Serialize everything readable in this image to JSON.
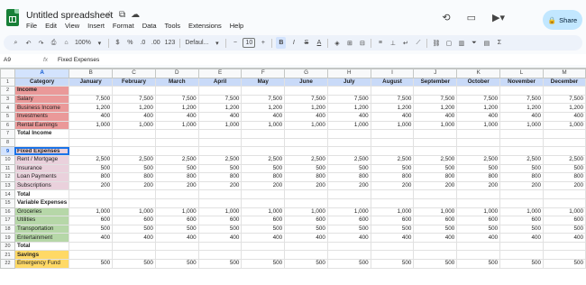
{
  "app": {
    "title": "Untitled spreadsheet",
    "menu": [
      "File",
      "Edit",
      "View",
      "Insert",
      "Format",
      "Data",
      "Tools",
      "Extensions",
      "Help"
    ],
    "share_label": "Share"
  },
  "toolbar": {
    "zoom": "100%",
    "currency": "$",
    "percent": "%",
    "dec_dec": ".0",
    "inc_dec": ".00",
    "format_123": "123",
    "font": "Defaul...",
    "font_size": "10",
    "minus": "−",
    "plus": "+",
    "bold": "B",
    "italic": "I",
    "strike": "S",
    "text_color": "A"
  },
  "formula_bar": {
    "cell_ref": "A9",
    "fx": "fx",
    "value": "Fixed Expenses"
  },
  "columns": [
    "A",
    "B",
    "C",
    "D",
    "E",
    "F",
    "G",
    "H",
    "I",
    "J",
    "K",
    "L",
    "M"
  ],
  "rows": [
    {
      "n": "1",
      "cells": [
        "Category",
        "January",
        "February",
        "March",
        "April",
        "May",
        "June",
        "July",
        "August",
        "September",
        "October",
        "November",
        "December"
      ],
      "type": "header"
    },
    {
      "n": "2",
      "cells": [
        "Income",
        "",
        "",
        "",
        "",
        "",
        "",
        "",
        "",
        "",
        "",
        "",
        ""
      ],
      "type": "section",
      "color": "red"
    },
    {
      "n": "3",
      "cells": [
        "Salary",
        "7,500",
        "7,500",
        "7,500",
        "7,500",
        "7,500",
        "7,500",
        "7,500",
        "7,500",
        "7,500",
        "7,500",
        "7,500",
        "7,500"
      ],
      "color": "red"
    },
    {
      "n": "4",
      "cells": [
        "Business Income",
        "1,200",
        "1,200",
        "1,200",
        "1,200",
        "1,200",
        "1,200",
        "1,200",
        "1,200",
        "1,200",
        "1,200",
        "1,200",
        "1,200"
      ],
      "color": "red"
    },
    {
      "n": "5",
      "cells": [
        "Investments",
        "400",
        "400",
        "400",
        "400",
        "400",
        "400",
        "400",
        "400",
        "400",
        "400",
        "400",
        "400"
      ],
      "color": "red"
    },
    {
      "n": "6",
      "cells": [
        "Rental Earnings",
        "1,000",
        "1,000",
        "1,000",
        "1,000",
        "1,000",
        "1,000",
        "1,000",
        "1,000",
        "1,000",
        "1,000",
        "1,000",
        "1,000"
      ],
      "color": "red"
    },
    {
      "n": "7",
      "cells": [
        "Total Income",
        "",
        "",
        "",
        "",
        "",
        "",
        "",
        "",
        "",
        "",
        "",
        ""
      ],
      "type": "bold"
    },
    {
      "n": "8",
      "cells": [
        "",
        "",
        "",
        "",
        "",
        "",
        "",
        "",
        "",
        "",
        "",
        "",
        ""
      ]
    },
    {
      "n": "9",
      "cells": [
        "Fixed Expenses",
        "",
        "",
        "",
        "",
        "",
        "",
        "",
        "",
        "",
        "",
        "",
        ""
      ],
      "type": "section",
      "color": "pink",
      "active": true
    },
    {
      "n": "10",
      "cells": [
        "Rent / Mortgage",
        "2,500",
        "2,500",
        "2,500",
        "2,500",
        "2,500",
        "2,500",
        "2,500",
        "2,500",
        "2,500",
        "2,500",
        "2,500",
        "2,500"
      ],
      "color": "pink"
    },
    {
      "n": "11",
      "cells": [
        "Insurance",
        "500",
        "500",
        "500",
        "500",
        "500",
        "500",
        "500",
        "500",
        "500",
        "500",
        "500",
        "500"
      ],
      "color": "pink"
    },
    {
      "n": "12",
      "cells": [
        "Loan Payments",
        "800",
        "800",
        "800",
        "800",
        "800",
        "800",
        "800",
        "800",
        "800",
        "800",
        "800",
        "800"
      ],
      "color": "pink"
    },
    {
      "n": "13",
      "cells": [
        "Subscriptions",
        "200",
        "200",
        "200",
        "200",
        "200",
        "200",
        "200",
        "200",
        "200",
        "200",
        "200",
        "200"
      ],
      "color": "pink"
    },
    {
      "n": "14",
      "cells": [
        "Total",
        "",
        "",
        "",
        "",
        "",
        "",
        "",
        "",
        "",
        "",
        "",
        ""
      ],
      "type": "bold"
    },
    {
      "n": "15",
      "cells": [
        "Variable Expenses",
        "",
        "",
        "",
        "",
        "",
        "",
        "",
        "",
        "",
        "",
        "",
        ""
      ],
      "type": "bold"
    },
    {
      "n": "16",
      "cells": [
        "Groceries",
        "1,000",
        "1,000",
        "1,000",
        "1,000",
        "1,000",
        "1,000",
        "1,000",
        "1,000",
        "1,000",
        "1,000",
        "1,000",
        "1,000"
      ],
      "color": "green"
    },
    {
      "n": "17",
      "cells": [
        "Utilities",
        "600",
        "600",
        "600",
        "600",
        "600",
        "600",
        "600",
        "600",
        "600",
        "600",
        "600",
        "600"
      ],
      "color": "green"
    },
    {
      "n": "18",
      "cells": [
        "Transportation",
        "500",
        "500",
        "500",
        "500",
        "500",
        "500",
        "500",
        "500",
        "500",
        "500",
        "500",
        "500"
      ],
      "color": "green"
    },
    {
      "n": "19",
      "cells": [
        "Entertainment",
        "400",
        "400",
        "400",
        "400",
        "400",
        "400",
        "400",
        "400",
        "400",
        "400",
        "400",
        "400"
      ],
      "color": "green"
    },
    {
      "n": "20",
      "cells": [
        "Total",
        "",
        "",
        "",
        "",
        "",
        "",
        "",
        "",
        "",
        "",
        "",
        ""
      ],
      "type": "bold"
    },
    {
      "n": "21",
      "cells": [
        "Savings",
        "",
        "",
        "",
        "",
        "",
        "",
        "",
        "",
        "",
        "",
        "",
        ""
      ],
      "type": "section",
      "color": "yellow"
    },
    {
      "n": "22",
      "cells": [
        "Emergency Fund",
        "500",
        "500",
        "500",
        "500",
        "500",
        "500",
        "500",
        "500",
        "500",
        "500",
        "500",
        "500"
      ],
      "color": "yellow"
    }
  ],
  "colors": {
    "red": "#ea9999",
    "pink": "#ead1dc",
    "green": "#b6d7a8",
    "yellow": "#ffd966",
    "header": "#c9daf8",
    "accent": "#0b57d0"
  }
}
